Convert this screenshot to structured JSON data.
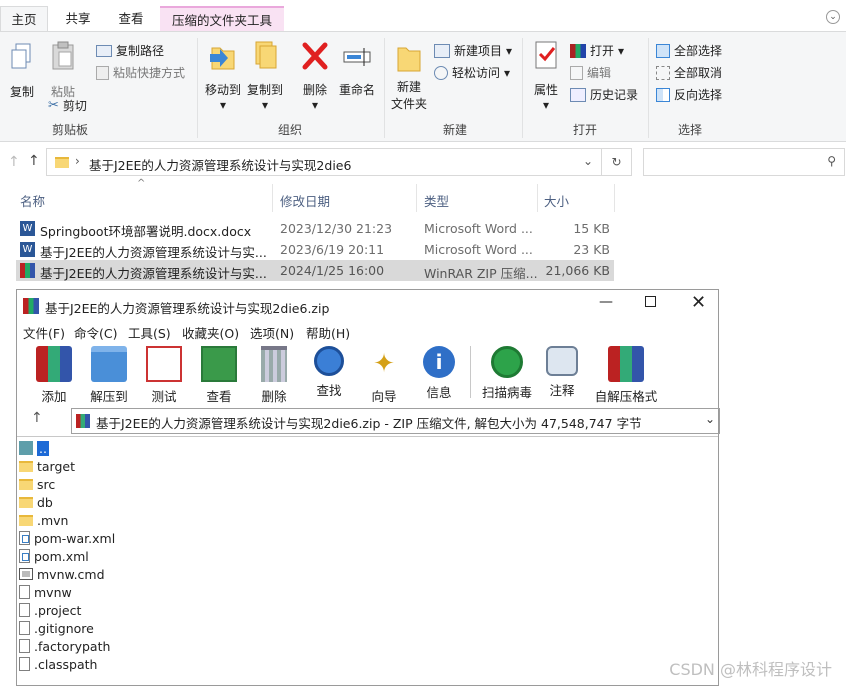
{
  "explorer": {
    "tabs": [
      {
        "label": "主页"
      },
      {
        "label": "共享"
      },
      {
        "label": "查看"
      },
      {
        "label": "压缩的文件夹工具"
      }
    ],
    "ribbon": {
      "groups": {
        "clipboard": {
          "label": "剪贴板",
          "copy": "复制",
          "paste": "粘贴",
          "copy_path": "复制路径",
          "paste_shortcut": "粘贴快捷方式",
          "cut": "剪切"
        },
        "organize": {
          "label": "组织",
          "move_to": "移动到",
          "copy_to": "复制到",
          "delete": "删除",
          "rename": "重命名"
        },
        "new": {
          "label": "新建",
          "new_folder_1": "新建",
          "new_folder_2": "文件夹",
          "new_item": "新建项目",
          "easy_access": "轻松访问"
        },
        "open": {
          "label": "打开",
          "properties": "属性",
          "open": "打开",
          "edit": "编辑",
          "history": "历史记录"
        },
        "select": {
          "label": "选择",
          "select_all": "全部选择",
          "select_none": "全部取消",
          "invert": "反向选择"
        }
      }
    },
    "address": {
      "path": "基于J2EE的人力资源管理系统设计与实现2die6"
    },
    "columns": {
      "name": "名称",
      "modified": "修改日期",
      "type": "类型",
      "size": "大小"
    },
    "files": [
      {
        "name": "Springboot环境部署说明.docx.docx",
        "modified": "2023/12/30 21:23",
        "type": "Microsoft Word ...",
        "size": "15 KB",
        "icon": "word-icon"
      },
      {
        "name": "基于J2EE的人力资源管理系统设计与实...",
        "modified": "2023/6/19 20:11",
        "type": "Microsoft Word ...",
        "size": "23 KB",
        "icon": "word-icon"
      },
      {
        "name": "基于J2EE的人力资源管理系统设计与实...",
        "modified": "2024/1/25 16:00",
        "type": "WinRAR ZIP 压缩...",
        "size": "21,066 KB",
        "icon": "winrar-icon"
      }
    ]
  },
  "winrar": {
    "title": "基于J2EE的人力资源管理系统设计与实现2die6.zip",
    "menu": [
      "文件(F)",
      "命令(C)",
      "工具(S)",
      "收藏夹(O)",
      "选项(N)",
      "帮助(H)"
    ],
    "toolbar": [
      "添加",
      "解压到",
      "测试",
      "查看",
      "删除",
      "查找",
      "向导",
      "信息",
      "扫描病毒",
      "注释",
      "自解压格式"
    ],
    "path_text": "基于J2EE的人力资源管理系统设计与实现2die6.zip - ZIP 压缩文件, 解包大小为 47,548,747 字节",
    "items": [
      {
        "name": "..",
        "kind": "up"
      },
      {
        "name": "target",
        "kind": "folder"
      },
      {
        "name": "src",
        "kind": "folder"
      },
      {
        "name": "db",
        "kind": "folder"
      },
      {
        "name": ".mvn",
        "kind": "folder"
      },
      {
        "name": "pom-war.xml",
        "kind": "xml"
      },
      {
        "name": "pom.xml",
        "kind": "xml"
      },
      {
        "name": "mvnw.cmd",
        "kind": "cmd"
      },
      {
        "name": "mvnw",
        "kind": "file"
      },
      {
        "name": ".project",
        "kind": "file"
      },
      {
        "name": ".gitignore",
        "kind": "file"
      },
      {
        "name": ".factorypath",
        "kind": "file"
      },
      {
        "name": ".classpath",
        "kind": "file"
      }
    ]
  },
  "watermark": "CSDN @林科程序设计"
}
